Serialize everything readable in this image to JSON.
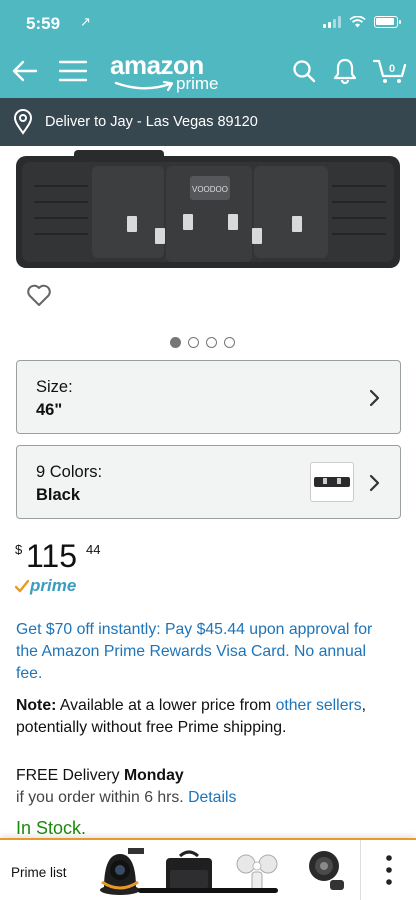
{
  "status_bar": {
    "time": "5:59",
    "location_arrow": "↗"
  },
  "header": {
    "back_icon": "back-arrow-icon",
    "menu_icon": "hamburger-menu-icon",
    "logo_main": "amazon",
    "logo_sub": "prime",
    "search_icon": "search-icon",
    "bell_icon": "bell-icon",
    "cart_icon": "cart-icon",
    "cart_count": "0"
  },
  "delivery_bar": {
    "text": "Deliver to Jay - Las Vegas 89120"
  },
  "carousel": {
    "page_count": 4,
    "active_index": 0
  },
  "size_selector": {
    "label": "Size:",
    "value": "46\""
  },
  "color_selector": {
    "label": "9 Colors:",
    "value": "Black"
  },
  "price": {
    "currency": "$",
    "whole": "115",
    "fraction": "44"
  },
  "prime_badge": {
    "text": "prime"
  },
  "promo": {
    "text": "Get $70 off instantly: Pay $45.44 upon approval for the Amazon Prime Rewards Visa Card. No annual fee."
  },
  "note": {
    "label": "Note:",
    "text_before": " Available at a lower price from ",
    "link": "other sellers",
    "text_after": ", potentially without free Prime shipping."
  },
  "delivery": {
    "free_text": "FREE Delivery ",
    "day": "Monday",
    "condition": "if you order within 6 hrs. ",
    "details_link": "Details"
  },
  "stock": {
    "text": "In Stock."
  },
  "bottom_tray": {
    "label": "Prime list",
    "items": [
      "security-camera-item",
      "laptop-bag-item",
      "motion-light-item",
      "spotlight-item"
    ]
  },
  "colors": {
    "teal": "#4fb8c0",
    "delivery_bar": "#37474f",
    "link": "#1e74b8",
    "prime_blue": "#3a9dc0",
    "in_stock": "#1b8a0c",
    "tray_accent": "#e79a2a"
  }
}
